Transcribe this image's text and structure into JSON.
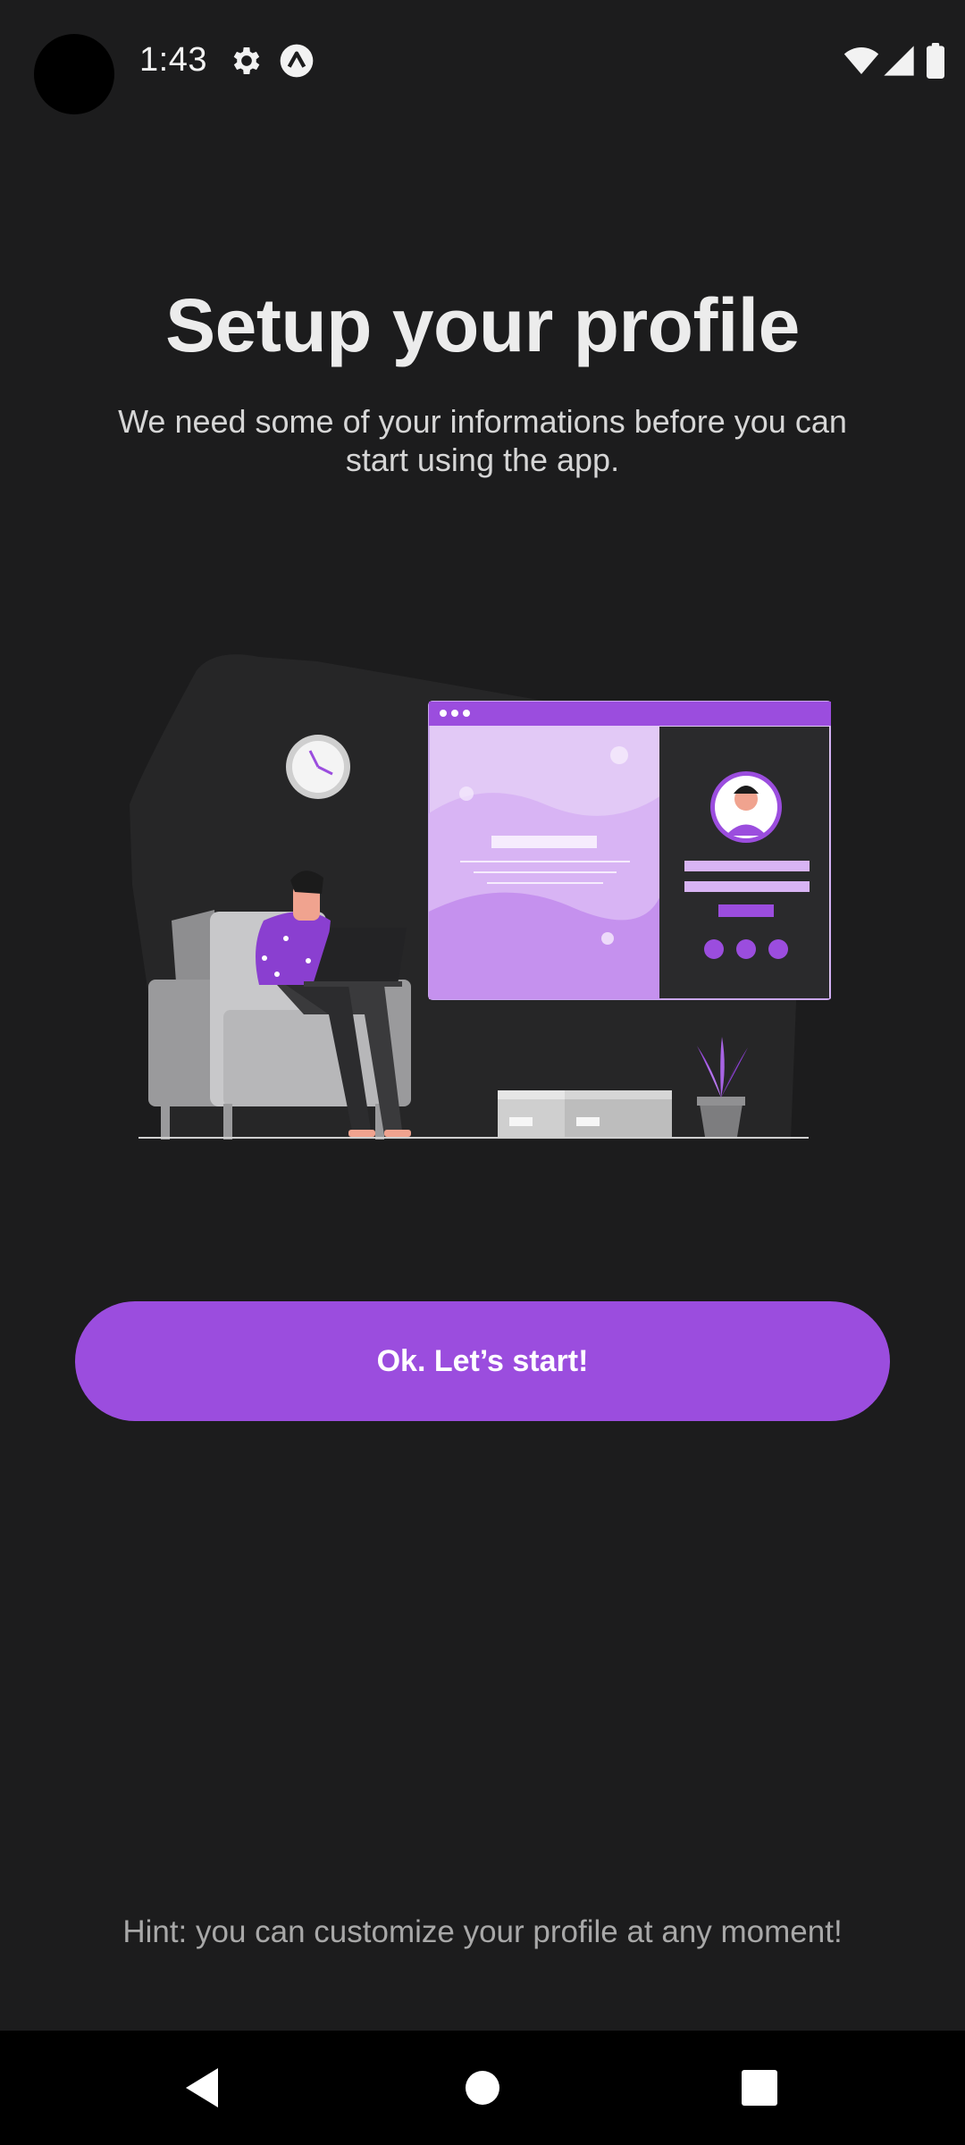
{
  "status_bar": {
    "time": "1:43",
    "icons": [
      "settings-icon",
      "app-notification-icon",
      "wifi-icon",
      "signal-icon",
      "battery-icon"
    ]
  },
  "content": {
    "title": "Setup your profile",
    "subtitle": "We need some of your informations before you can start using the app.",
    "illustration": "person-on-armchair-with-laptop-and-profile-window",
    "start_button_label": "Ok. Let’s start!",
    "hint": "Hint: you can customize your profile at any moment!"
  },
  "nav_bar": {
    "items": [
      "back-icon",
      "home-icon",
      "recents-icon"
    ]
  },
  "colors": {
    "background": "#1c1c1d",
    "accent": "#9b4dde",
    "text_primary": "#ececec",
    "text_secondary": "#d6d6d6",
    "text_hint": "#a8a8a8"
  }
}
